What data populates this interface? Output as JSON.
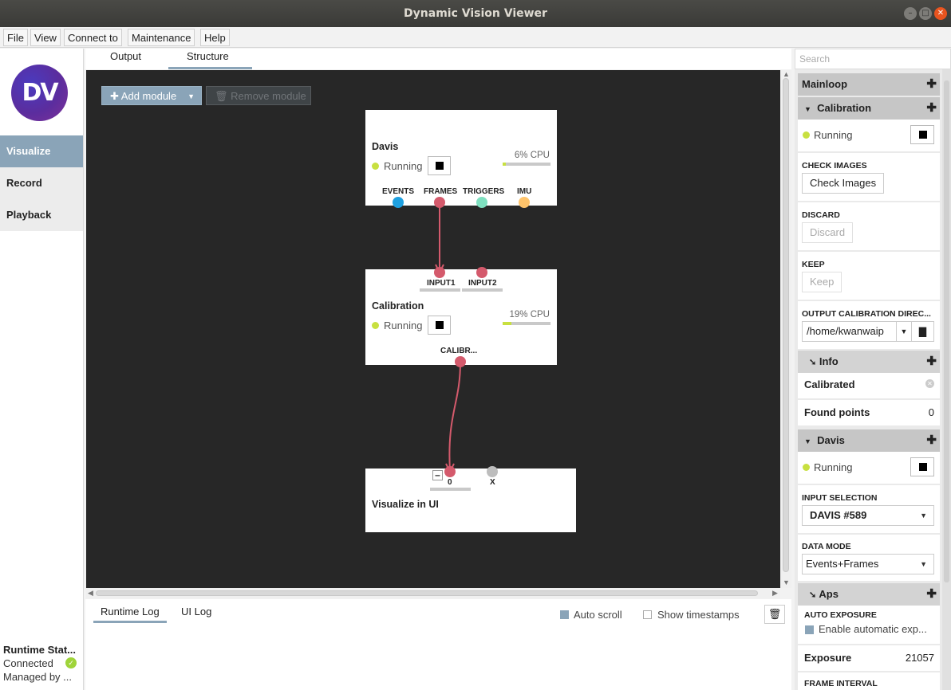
{
  "window": {
    "title": "Dynamic Vision Viewer"
  },
  "menu": [
    "File",
    "View",
    "Connect to",
    "Maintenance",
    "Help"
  ],
  "logo": {
    "text": "DV"
  },
  "nav": [
    "Visualize",
    "Record",
    "Playback"
  ],
  "runtime": {
    "title": "Runtime Stat...",
    "status": "Connected",
    "managed": "Managed by ..."
  },
  "tabs": [
    "Output",
    "Structure"
  ],
  "toolbar": {
    "add_label": "Add module",
    "remove_label": "Remove module"
  },
  "modules": {
    "davis": {
      "name": "Davis",
      "status": "Running",
      "cpu": "6% CPU",
      "cpu_fraction": 0.06,
      "outputs": [
        "EVENTS",
        "FRAMES",
        "TRIGGERS",
        "IMU"
      ]
    },
    "calibration": {
      "name": "Calibration",
      "status": "Running",
      "cpu": "19% CPU",
      "cpu_fraction": 0.19,
      "inputs": [
        "INPUT1",
        "INPUT2"
      ],
      "outputs": [
        "CALIBR..."
      ]
    },
    "visualize": {
      "name": "Visualize in UI",
      "inputs": [
        "0",
        "X"
      ],
      "collapse_symbol": "–"
    }
  },
  "log": {
    "tabs": [
      "Runtime Log",
      "UI Log"
    ],
    "auto_scroll": "Auto scroll",
    "auto_scroll_checked": true,
    "show_timestamps": "Show timestamps",
    "show_timestamps_checked": false
  },
  "right": {
    "search_placeholder": "Search",
    "mainloop": "Mainloop",
    "calibration": {
      "title": "Calibration",
      "status": "Running",
      "check_images_label": "CHECK IMAGES",
      "check_images_button": "Check Images",
      "discard_label": "DISCARD",
      "discard_button": "Discard",
      "keep_label": "KEEP",
      "keep_button": "Keep",
      "output_dir_label": "OUTPUT CALIBRATION DIREC...",
      "output_dir_value": "/home/kwanwaip"
    },
    "info": {
      "title": "Info",
      "calibrated_label": "Calibrated",
      "found_points_label": "Found points",
      "found_points_value": "0"
    },
    "davis": {
      "title": "Davis",
      "status": "Running",
      "input_selection_label": "INPUT SELECTION",
      "input_selection_value": "DAVIS #589",
      "data_mode_label": "DATA MODE",
      "data_mode_value": "Events+Frames"
    },
    "aps": {
      "title": "Aps",
      "auto_exposure_label": "AUTO EXPOSURE",
      "auto_exposure_text": "Enable automatic exp...",
      "exposure_label": "Exposure",
      "exposure_value": "21057",
      "frame_interval_label": "FRAME INTERVAL"
    }
  },
  "colors": {
    "accent": "#8aa4b8",
    "canvas": "#272727",
    "running": "#c8e040",
    "frames_port": "#d45a6c",
    "events_port": "#1ea0e0",
    "triggers_port": "#7fe0c0",
    "imu_port": "#ffc46b"
  }
}
